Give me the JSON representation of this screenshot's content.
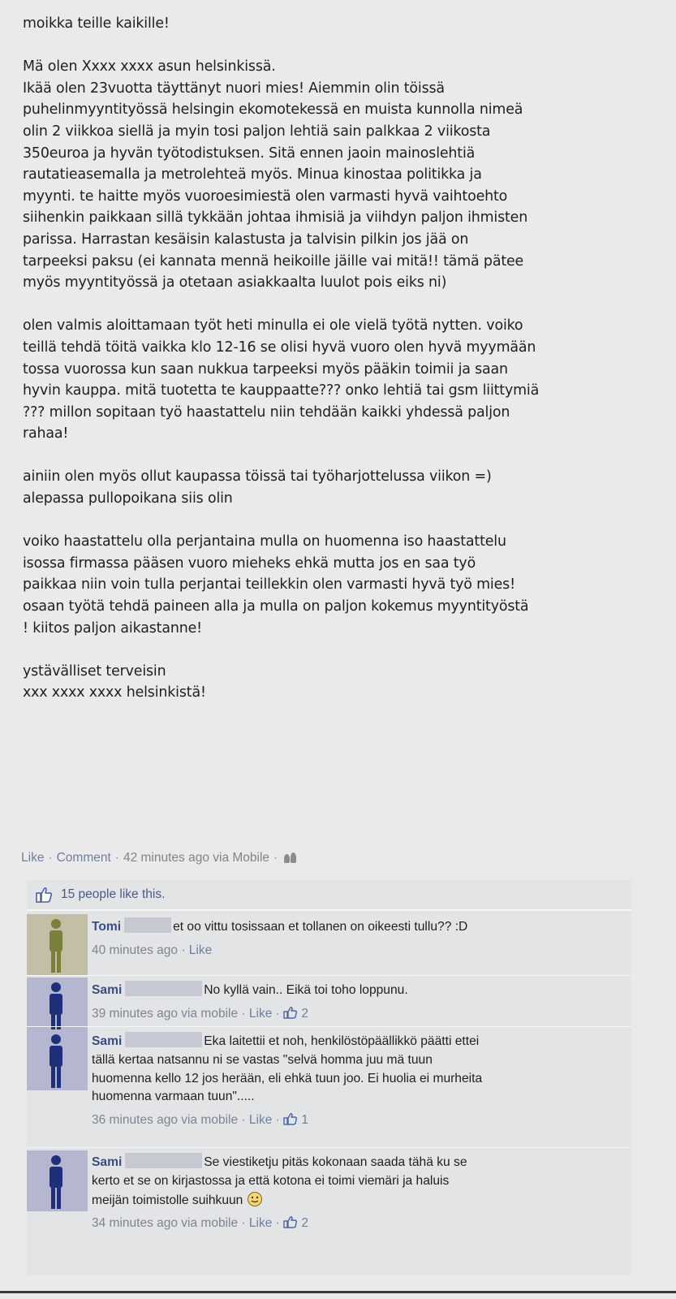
{
  "post": {
    "greeting": "moikka teille kaikille!",
    "para1": [
      "Mä olen Xxxx xxxx asun helsinkissä.",
      "Ikää olen 23vuotta täyttänyt nuori mies! Aiemmin olin töissä",
      "puhelinmyyntityössä helsingin ekomotekessä en muista kunnolla nimeä",
      "olin 2 viikkoa siellä ja myin tosi paljon lehtiä sain palkkaa 2 viikosta",
      "350euroa ja hyvän työtodistuksen. Sitä ennen jaoin mainoslehtiä",
      "rautatieasemalla ja metrolehteä myös. Minua kinostaa politikka ja",
      "myynti. te haitte myös vuoroesimiestä olen varmasti hyvä vaihtoehto",
      "siihenkin paikkaan sillä tykkään johtaa ihmisiä ja viihdyn paljon ihmisten",
      "parissa. Harrastan kesäisin kalastusta ja talvisin pilkin jos jää on",
      "tarpeeksi paksu (ei kannata mennä heikoille jäille vai mitä!! tämä pätee",
      "myös myyntityössä ja otetaan asiakkaalta luulot pois eiks ni)"
    ],
    "para2": [
      "olen valmis aloittamaan työt heti minulla ei ole vielä työtä nytten. voiko",
      "teillä tehdä töitä vaikka klo 12-16 se olisi hyvä vuoro olen hyvä myymään",
      "tossa vuorossa kun saan nukkua tarpeeksi myös pääkin toimii ja saan",
      "hyvin kauppa. mitä tuotetta te kauppaatte??? onko lehtiä tai gsm liittymiä",
      "??? millon sopitaan työ haastattelu niin tehdään kaikki yhdessä paljon",
      "rahaa!"
    ],
    "para3": [
      "ainiin olen myös ollut kaupassa töissä tai työharjottelussa viikon =)",
      "alepassa pullopoikana siis olin"
    ],
    "para4": [
      "voiko haastattelu olla perjantaina mulla on huomenna iso haastattelu",
      "isossa firmassa pääsen vuoro mieheks ehkä mutta jos en saa työ",
      "paikkaa niin voin tulla perjantai teillekkin olen varmasti hyvä työ mies!",
      "osaan työtä tehdä paineen alla ja mulla on paljon kokemus myyntityöstä",
      "! kiitos paljon aikastanne!"
    ],
    "signoff": [
      "ystävälliset terveisin",
      "xxx xxxx xxxx helsinkistä!"
    ]
  },
  "actions": {
    "like": "Like",
    "comment": "Comment",
    "time": "42 minutes ago via Mobile",
    "separator": "·"
  },
  "likes": {
    "text": "15 people like this."
  },
  "comments": [
    {
      "name": "Tomi",
      "lines": [
        "et oo vittu tosissaan et tollanen on oikeesti tullu?? :D"
      ],
      "time": "40 minutes ago",
      "like": "Like",
      "count": ""
    },
    {
      "name": "Sami",
      "lines": [
        "No kyllä vain.. Eikä toi toho loppunu."
      ],
      "time": "39 minutes ago via mobile",
      "like": "Like",
      "count": "2"
    },
    {
      "name": "Sami",
      "lines": [
        "Eka laitettii et noh, henkilöstöpäällikkö päätti ettei",
        "tällä kertaa natsannu ni se vastas \"selvä homma juu mä tuun",
        "huomenna kello 12 jos herään, eli ehkä tuun joo. Ei huolia ei murheita",
        "huomenna varmaan tuun\"....."
      ],
      "time": "36 minutes ago via mobile",
      "like": "Like",
      "count": "1"
    },
    {
      "name": "Sami",
      "lines": [
        "Se viestiketju pitäs kokonaan saada tähä ku se",
        "kerto et se on kirjastossa ja että kotona ei toimi viemäri ja haluis",
        "meijän toimistolle suihkuun"
      ],
      "time": "34 minutes ago via mobile",
      "like": "Like",
      "count": "2"
    }
  ],
  "colors": {
    "background": "#eaeaea",
    "link": "#3b4c82",
    "meta": "#7d8590",
    "comment_box": "#e3e4e6"
  }
}
